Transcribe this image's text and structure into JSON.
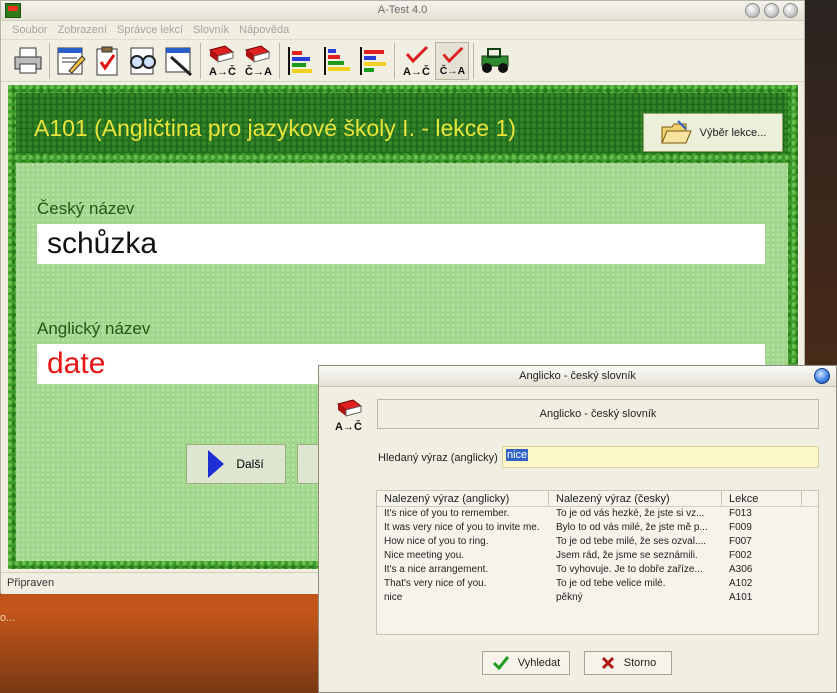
{
  "window": {
    "title": "A-Test 4.0",
    "icon_text": "Test"
  },
  "menu": [
    "Soubor",
    "Zobrazení",
    "Správce lekcí",
    "Slovník",
    "Nápověda"
  ],
  "toolbar": {
    "icon_labels": {
      "ac": "A→Č",
      "ca": "Č→A",
      "check_ac": "A→Č",
      "check_ca": "Č→A"
    }
  },
  "lesson": {
    "title": "A101 (Angličtina pro jazykové školy I. - lekce 1)",
    "select_button": "Výběr lekce..."
  },
  "form": {
    "czech_label": "Český název",
    "czech_value": "schůzka",
    "english_label": "Anglický název",
    "english_value": "date",
    "next_button": "Další"
  },
  "status": {
    "text": "Připraven"
  },
  "side_text": "o...",
  "dialog": {
    "title": "Anglicko - český slovník",
    "icon_label": "A→Č",
    "caption": "Anglicko - český slovník",
    "search_label": "Hledaný výraz (anglicky)",
    "search_value": "nice",
    "columns": [
      "Nalezený výraz (anglicky)",
      "Nalezený výraz (česky)",
      "Lekce"
    ],
    "rows": [
      {
        "en": "It's nice of you to remember.",
        "cz": "To je od vás hezké, že jste si vz...",
        "lesson": "F013"
      },
      {
        "en": "It was very nice of you to invite me.",
        "cz": "Bylo to od vás milé, že jste mě p...",
        "lesson": "F009"
      },
      {
        "en": "How nice of you to ring.",
        "cz": "To je od tebe milé, že ses ozval....",
        "lesson": "F007"
      },
      {
        "en": "Nice meeting you.",
        "cz": "Jsem rád, že jsme se seznámili.",
        "lesson": "F002"
      },
      {
        "en": "It's a nice arrangement.",
        "cz": "To vyhovuje. Je to dobře zaříze...",
        "lesson": "A306"
      },
      {
        "en": "That's very nice of you.",
        "cz": "To je od tebe velice milé.",
        "lesson": "A102"
      },
      {
        "en": "nice",
        "cz": "pěkný",
        "lesson": "A101"
      }
    ],
    "search_button": "Vyhledat",
    "cancel_button": "Storno"
  },
  "colors": {
    "lesson_title": "#e8e43a",
    "english_value": "#e81414",
    "field_label": "#1e5a16",
    "green_frame": "#3c9b2c"
  }
}
